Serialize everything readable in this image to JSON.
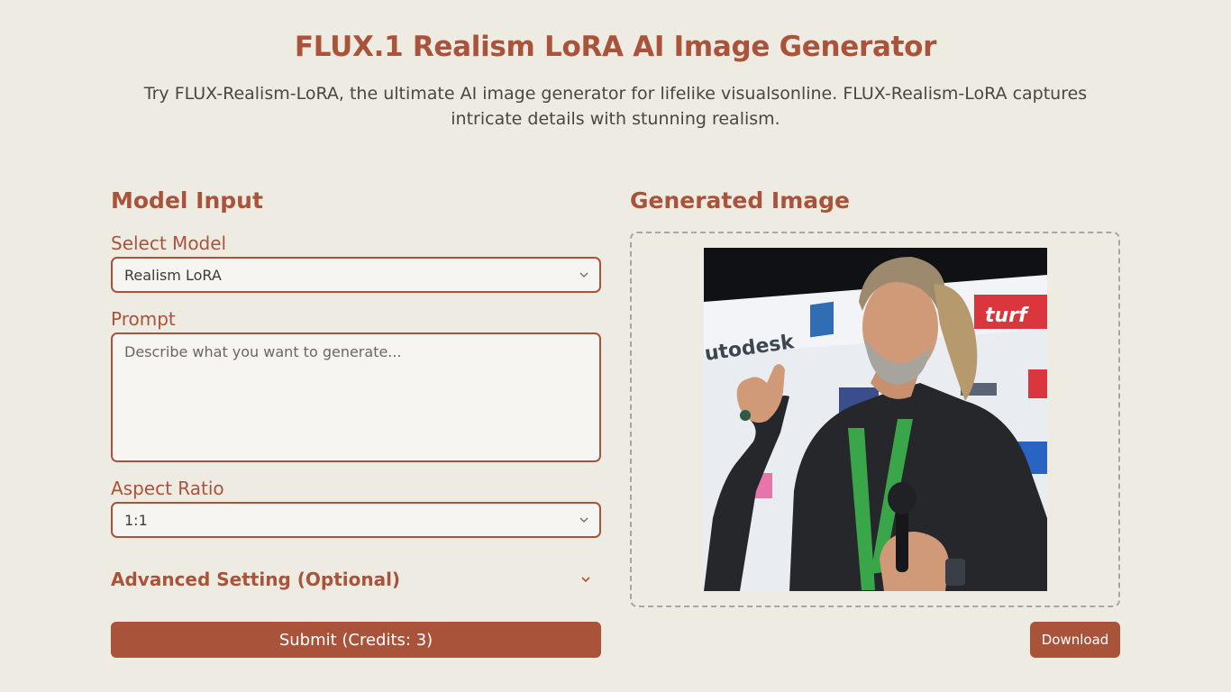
{
  "header": {
    "title": "FLUX.1 Realism LoRA AI Image Generator",
    "subtitle": "Try FLUX-Realism-LoRA, the ultimate AI image generator for lifelike visualsonline. FLUX-Realism-LoRA captures intricate details with stunning realism."
  },
  "input_panel": {
    "heading": "Model Input",
    "model": {
      "label": "Select Model",
      "selected": "Realism LoRA"
    },
    "prompt": {
      "label": "Prompt",
      "value": "",
      "placeholder": "Describe what you want to generate..."
    },
    "aspect_ratio": {
      "label": "Aspect Ratio",
      "selected": "1:1"
    },
    "advanced": {
      "label": "Advanced Setting (Optional)",
      "expanded": false
    },
    "submit_label": "Submit (Credits: 3)"
  },
  "output_panel": {
    "heading": "Generated Image",
    "image_icon": "photo-of-speaker-with-microphone",
    "download_label": "Download"
  },
  "colors": {
    "accent": "#a9533b",
    "background": "#eeebe3",
    "field_background": "#f6f5f2",
    "frame_border": "#a6a6aa"
  }
}
